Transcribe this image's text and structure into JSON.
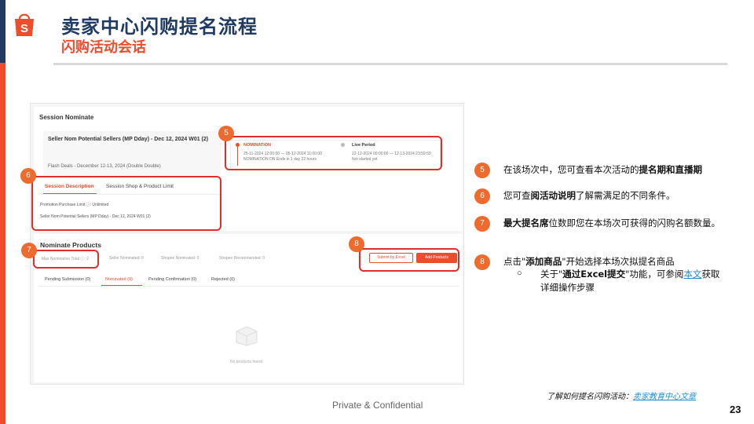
{
  "header": {
    "title": "卖家中心闪购提名流程",
    "subtitle": "闪购活动会话"
  },
  "screenshot": {
    "section_title": "Session Nominate",
    "session_name": "Seller Nom Potential Sellers (MP Dday) - Dec 12, 2024 W01 (2)",
    "flash_deals": "Flash Deals - December 12-13, 2024 (Double Double)",
    "nomination_label": "NOMINATION",
    "nomination_dates": "25-11-2024 12:00:00 — 05-12-2024 11:00:00",
    "nomination_ends": "NOMINATION ON Ends in 1 day 22 hours",
    "live_label": "Live Period",
    "live_dates": "12-12-2024 00:00:00 — 12-13-2024 23:59:59",
    "live_status": "Not started yet",
    "tab_description": "Session Description",
    "tab_limit": "Session Shop & Product Limit",
    "promo_limit": "Promotion Purchase Limit ⓘ: Unlimited",
    "desc_session": "Seller Nom Potential Sellers (MP Dday) - Dec 12, 2024 W01 (2)",
    "nominate_title": "Nominate Products",
    "stat_max": "Max Nomination Total ⓘ: 2",
    "stat_seller": "Seller Nominated: 0",
    "stat_shopee": "Shopee Nominated: 0",
    "stat_recommended": "Shopee Recommended: 0",
    "btn_excel": "Submit by Excel",
    "btn_add": "Add Products",
    "status_tabs": [
      "Pending Submission (0)",
      "Nominated (0)",
      "Pending Confirmation (0)",
      "Rejected (0)"
    ],
    "empty_text": "No products found"
  },
  "markers": [
    "5",
    "6",
    "7",
    "8"
  ],
  "notes": [
    {
      "num": "5",
      "pre": "在该场次中，您可查看本次活动的",
      "bold": "提名期和直播期",
      "post": ""
    },
    {
      "num": "6",
      "pre": "您可查",
      "bold": "阅活动说明",
      "post": "了解需满足的不同条件。"
    },
    {
      "num": "7",
      "pre": "",
      "bold": "最大提名席",
      "post": "位数即您在本场次可获得的闪购名额数量。"
    },
    {
      "num": "8",
      "pre": "点击\"",
      "bold": "添加商品",
      "post": "\"开始选择本场次拟提名商品"
    }
  ],
  "sub_note": {
    "bullet": "○",
    "pre": "关于\"",
    "bold": "通过Excel提交",
    "mid": "\"功能，可参阅",
    "link": "本文",
    "post": "获取详细操作步骤"
  },
  "footer": {
    "confidential": "Private & Confidential",
    "note_prefix": "了解如何提名闪购活动：",
    "note_link": "卖家教育中心文章",
    "page": "23"
  },
  "colors": {
    "brand_orange": "#ee4d2d",
    "navy": "#1f3a63",
    "marker": "#ee6a2d",
    "highlight_red": "#e02d2d"
  }
}
